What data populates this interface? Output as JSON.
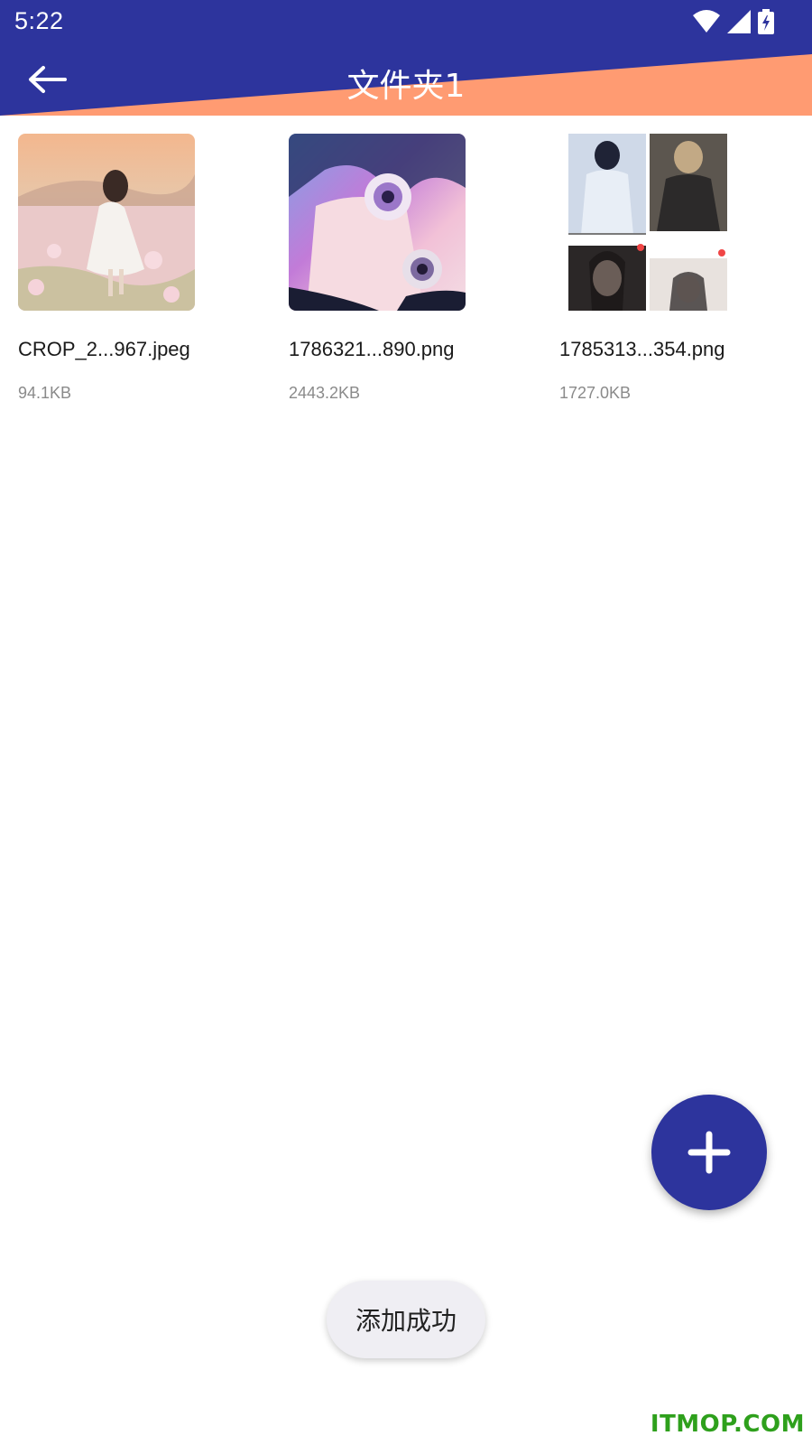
{
  "status_bar": {
    "time": "5:22",
    "icons": [
      "wifi-icon",
      "signal-icon",
      "battery-charging-icon"
    ]
  },
  "header": {
    "title": "文件夹1",
    "back_icon": "arrow-left-icon"
  },
  "colors": {
    "primary": "#2d349d",
    "accent": "#ff9b72",
    "background": "#ffffff",
    "secondary_text": "#8a8a8a",
    "watermark": "#2ea01c"
  },
  "files": [
    {
      "name": "CROP_2...967.jpeg",
      "size": "94.1KB"
    },
    {
      "name": "1786321...890.png",
      "size": "2443.2KB"
    },
    {
      "name": "1785313...354.png",
      "size": "1727.0KB"
    }
  ],
  "fab": {
    "icon": "plus-icon"
  },
  "toast": {
    "message": "添加成功"
  },
  "watermark": {
    "text": "ITMOP.COM"
  }
}
